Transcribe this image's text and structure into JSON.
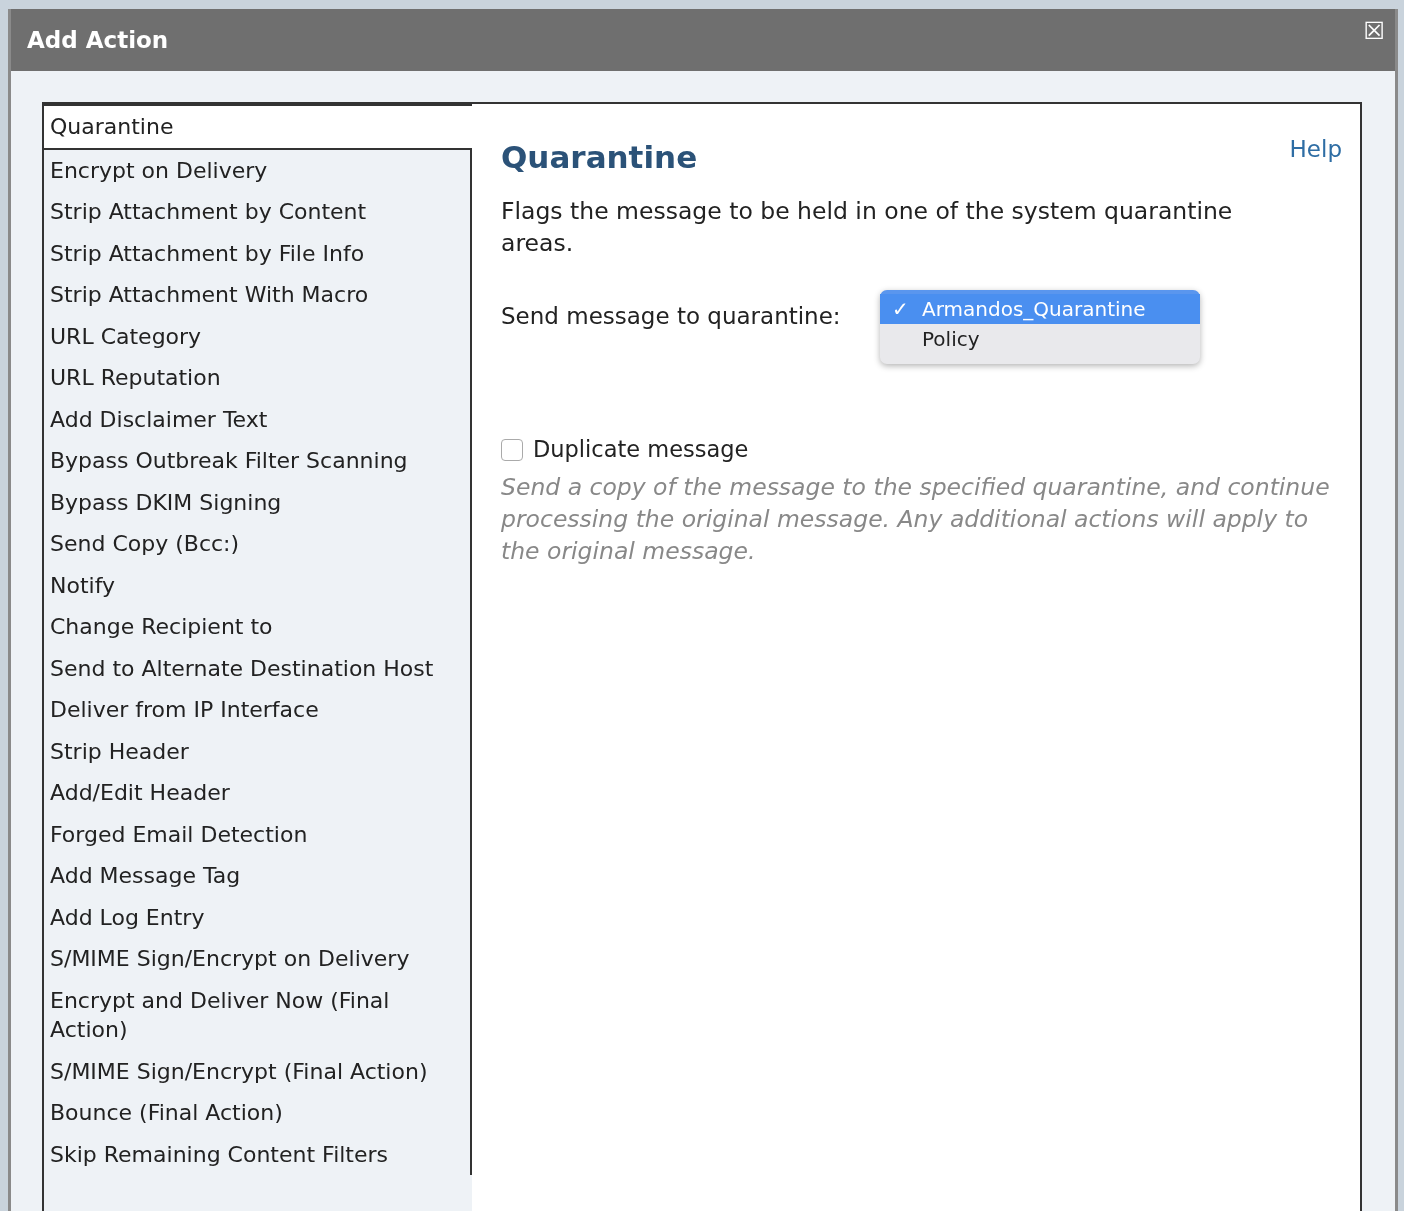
{
  "dialog": {
    "title": "Add Action",
    "close_symbol": "☒"
  },
  "actions": [
    {
      "label": "Quarantine",
      "selected": true
    },
    {
      "label": "Encrypt on Delivery",
      "selected": false
    },
    {
      "label": "Strip Attachment by Content",
      "selected": false
    },
    {
      "label": "Strip Attachment by File Info",
      "selected": false
    },
    {
      "label": "Strip Attachment With Macro",
      "selected": false
    },
    {
      "label": "URL Category",
      "selected": false
    },
    {
      "label": "URL Reputation",
      "selected": false
    },
    {
      "label": "Add Disclaimer Text",
      "selected": false
    },
    {
      "label": "Bypass Outbreak Filter Scanning",
      "selected": false
    },
    {
      "label": "Bypass DKIM Signing",
      "selected": false
    },
    {
      "label": "Send Copy (Bcc:)",
      "selected": false
    },
    {
      "label": "Notify",
      "selected": false
    },
    {
      "label": "Change Recipient to",
      "selected": false
    },
    {
      "label": "Send to Alternate Destination Host",
      "selected": false
    },
    {
      "label": "Deliver from IP Interface",
      "selected": false
    },
    {
      "label": "Strip Header",
      "selected": false
    },
    {
      "label": "Add/Edit Header",
      "selected": false
    },
    {
      "label": "Forged Email Detection",
      "selected": false
    },
    {
      "label": "Add Message Tag",
      "selected": false
    },
    {
      "label": "Add Log Entry",
      "selected": false
    },
    {
      "label": "S/MIME Sign/Encrypt on Delivery",
      "selected": false
    },
    {
      "label": "Encrypt and Deliver Now (Final Action)",
      "selected": false
    },
    {
      "label": "S/MIME Sign/Encrypt (Final Action)",
      "selected": false
    },
    {
      "label": "Bounce (Final Action)",
      "selected": false
    },
    {
      "label": "Skip Remaining Content Filters",
      "selected": false
    }
  ],
  "detail": {
    "heading": "Quarantine",
    "help": "Help",
    "description": "Flags the message to be held in one of the system quarantine areas.",
    "quarantine_label": "Send message to quarantine:",
    "quarantine_options": [
      {
        "label": "Armandos_Quarantine",
        "selected": true
      },
      {
        "label": "Policy",
        "selected": false
      }
    ],
    "check_mark": "✓",
    "duplicate": {
      "label": "Duplicate message",
      "checked": false
    },
    "note": "Send a copy of the message to the specified quarantine, and continue processing the original message. Any additional actions will apply to the original message."
  }
}
